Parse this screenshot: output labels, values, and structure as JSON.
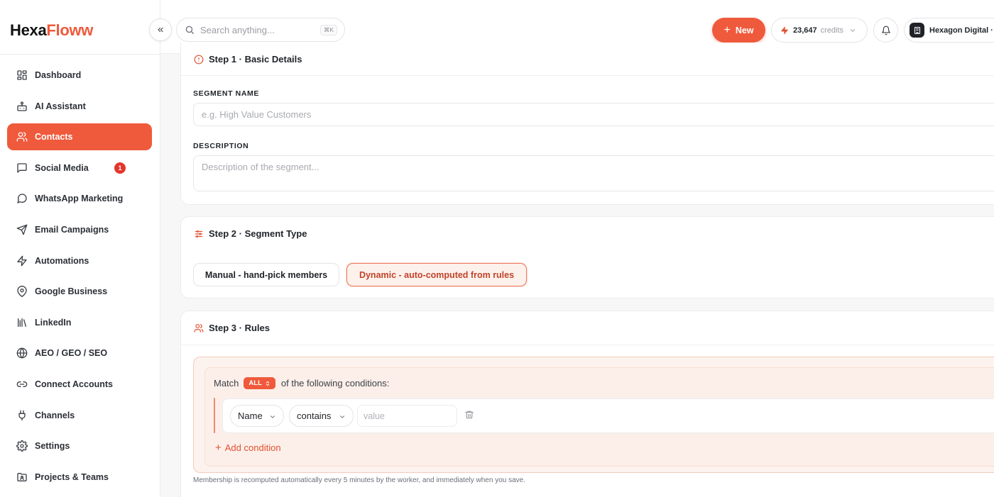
{
  "brand": {
    "name_part1": "Hexa",
    "name_part2": "Floww",
    "accent": "#ef5a3c"
  },
  "sidebar": {
    "items": [
      {
        "label": "Dashboard",
        "icon": "grid-icon"
      },
      {
        "label": "AI Assistant",
        "icon": "bot-icon"
      },
      {
        "label": "Contacts",
        "icon": "users-icon",
        "active": true
      },
      {
        "label": "Social Media",
        "icon": "message-square-icon",
        "badge": "1"
      },
      {
        "label": "WhatsApp Marketing",
        "icon": "message-circle-icon"
      },
      {
        "label": "Email Campaigns",
        "icon": "send-icon"
      },
      {
        "label": "Automations",
        "icon": "zap-icon"
      },
      {
        "label": "Google Business",
        "icon": "map-pin-icon"
      },
      {
        "label": "LinkedIn",
        "icon": "library-icon"
      },
      {
        "label": "AEO / GEO / SEO",
        "icon": "globe-icon"
      },
      {
        "label": "Connect Accounts",
        "icon": "link-icon"
      },
      {
        "label": "Channels",
        "icon": "plug-icon"
      },
      {
        "label": "Settings",
        "icon": "gear-icon"
      },
      {
        "label": "Projects & Teams",
        "icon": "folder-users-icon"
      }
    ]
  },
  "topbar": {
    "search_placeholder": "Search anything...",
    "search_shortcut": "⌘K",
    "new_label": "New",
    "credits_value": "23,647",
    "credits_label": "credits",
    "workspace_name": "Hexagon Digital · D"
  },
  "step1": {
    "title": "Step 1 · Basic Details",
    "segment_name_label": "SEGMENT NAME",
    "segment_name_placeholder": "e.g. High Value Customers",
    "description_label": "DESCRIPTION",
    "description_placeholder": "Description of the segment..."
  },
  "step2": {
    "title": "Step 2 · Segment Type",
    "manual_label": "Manual - hand-pick members",
    "dynamic_label": "Dynamic - auto-computed from rules",
    "selected": "dynamic"
  },
  "step3": {
    "title": "Step 3 · Rules",
    "match_prefix": "Match",
    "match_mode": "ALL",
    "match_suffix": "of the following conditions:",
    "condition": {
      "field": "Name",
      "operator": "contains",
      "value_placeholder": "value"
    },
    "add_condition_label": "Add condition",
    "footnote": "Membership is recomputed automatically every 5 minutes by the worker, and immediately when you save."
  }
}
